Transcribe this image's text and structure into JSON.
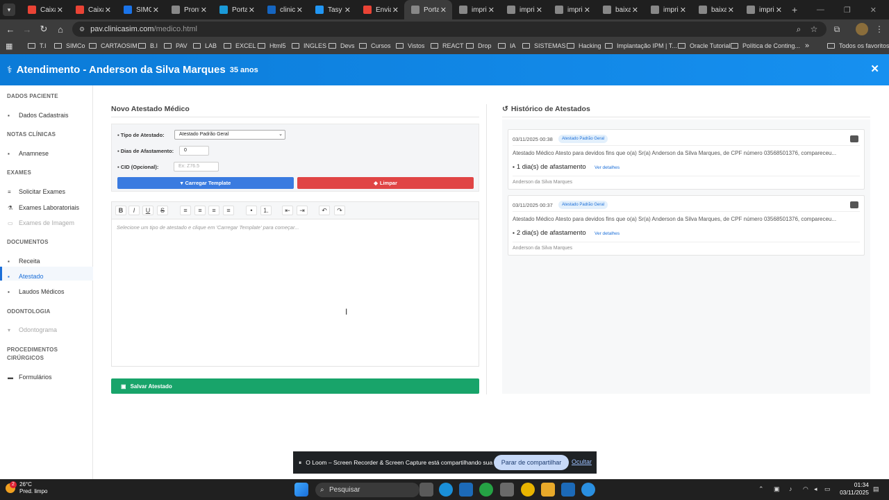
{
  "browser": {
    "tabs": [
      {
        "title": "Caixa",
        "icon": "gmail-icon",
        "color": "#ea4335"
      },
      {
        "title": "Caixa",
        "icon": "gmail-icon",
        "color": "#ea4335"
      },
      {
        "title": "SIMCo",
        "icon": "app-icon",
        "color": "#1a73e8"
      },
      {
        "title": "Pront",
        "icon": "globe-icon",
        "color": "#888888"
      },
      {
        "title": "Portal",
        "icon": "app-icon",
        "color": "#1a9ad8"
      },
      {
        "title": "clinica",
        "icon": "app-icon",
        "color": "#1565c0"
      },
      {
        "title": "Tasy",
        "icon": "app-icon",
        "color": "#2196f3"
      },
      {
        "title": "Enviad",
        "icon": "gmail-icon",
        "color": "#ea4335"
      },
      {
        "title": "Portal",
        "icon": "globe-icon",
        "color": "#888888"
      },
      {
        "title": "imprim",
        "icon": "globe-icon",
        "color": "#888888"
      },
      {
        "title": "imprim",
        "icon": "globe-icon",
        "color": "#888888"
      },
      {
        "title": "imprim",
        "icon": "globe-icon",
        "color": "#888888"
      },
      {
        "title": "baixar",
        "icon": "globe-icon",
        "color": "#888888"
      },
      {
        "title": "imprim",
        "icon": "globe-icon",
        "color": "#888888"
      },
      {
        "title": "baixar",
        "icon": "globe-icon",
        "color": "#888888"
      },
      {
        "title": "imprim",
        "icon": "globe-icon",
        "color": "#888888"
      }
    ],
    "new_tab": "+",
    "url_host": "pav.clinicasim.com",
    "url_path": "/medico.html",
    "bookmarks": [
      {
        "label": "T.I"
      },
      {
        "label": "SIMCo"
      },
      {
        "label": "CARTAOSIM"
      },
      {
        "label": "B.I"
      },
      {
        "label": "PAV"
      },
      {
        "label": "LAB"
      },
      {
        "label": "EXCEL"
      },
      {
        "label": "Html5"
      },
      {
        "label": "INGLES"
      },
      {
        "label": "Devs"
      },
      {
        "label": "Cursos"
      },
      {
        "label": "Vistos"
      },
      {
        "label": "REACT"
      },
      {
        "label": "Drop"
      },
      {
        "label": "IA"
      },
      {
        "label": "SISTEMAS"
      },
      {
        "label": "Hacking"
      },
      {
        "label": "Implantação IPM | T..."
      },
      {
        "label": "Oracle Tutorial"
      },
      {
        "label": "Política de Conting..."
      }
    ],
    "bookmarks_more": "»",
    "all_favorites": "Todos os favoritos"
  },
  "header": {
    "title": "Atendimento -  Anderson da Silva Marques",
    "age": "35 anos",
    "close": "✕",
    "accent": "#0b7bd8"
  },
  "sidebar": {
    "sections": [
      {
        "title": "DADOS PACIENTE",
        "items": [
          {
            "label": "Dados Cadastrais",
            "icon": "user-icon",
            "state": "normal"
          }
        ]
      },
      {
        "title": "NOTAS CLÍNICAS",
        "items": [
          {
            "label": "Anamnese",
            "icon": "clipboard-icon",
            "state": "normal"
          }
        ]
      },
      {
        "title": "EXAMES",
        "items": [
          {
            "label": "Solicitar Exames",
            "icon": "list-icon",
            "state": "normal"
          },
          {
            "label": "Exames Laboratoriais",
            "icon": "flask-icon",
            "state": "normal"
          },
          {
            "label": "Exames de Imagem",
            "icon": "image-icon",
            "state": "disabled"
          }
        ]
      },
      {
        "title": "DOCUMENTOS",
        "items": [
          {
            "label": "Receita",
            "icon": "prescription-icon",
            "state": "normal"
          },
          {
            "label": "Atestado",
            "icon": "document-icon",
            "state": "active"
          },
          {
            "label": "Laudos Médicos",
            "icon": "report-icon",
            "state": "normal"
          }
        ]
      },
      {
        "title": "ODONTOLOGIA",
        "items": [
          {
            "label": "Odontograma",
            "icon": "tooth-icon",
            "state": "disabled"
          }
        ]
      },
      {
        "title": "PROCEDIMENTOS CIRÚRGICOS",
        "items": [
          {
            "label": "Formulários",
            "icon": "form-icon",
            "state": "normal"
          }
        ]
      }
    ]
  },
  "form": {
    "title": "Novo Atestado Médico",
    "tipo_label": "Tipo de Atestado:",
    "tipo_value": "Atestado Padrão Geral",
    "dias_label": "Dias de Afastamento:",
    "dias_value": "0",
    "cid_label": "CID (Opcional):",
    "cid_placeholder": "Ex: Z76.5",
    "load_button": "Carregar Template",
    "clear_button": "Limpar",
    "load_color": "#3a7be0",
    "clear_color": "#e04545",
    "editor_placeholder": "Selecione um tipo de atestado e clique em 'Carregar Template' para começar...",
    "save_button": "Salvar Atestado",
    "save_color": "#18a46a"
  },
  "editor_toolbar": [
    {
      "name": "bold",
      "glyph": "B"
    },
    {
      "name": "italic",
      "glyph": "I"
    },
    {
      "name": "underline",
      "glyph": "U"
    },
    {
      "name": "strike",
      "glyph": "S"
    },
    {
      "name": "align-left",
      "glyph": "≡"
    },
    {
      "name": "align-center",
      "glyph": "≡"
    },
    {
      "name": "align-right",
      "glyph": "≡"
    },
    {
      "name": "justify",
      "glyph": "≡"
    },
    {
      "name": "bullet-list",
      "glyph": "•"
    },
    {
      "name": "numbered-list",
      "glyph": "1."
    },
    {
      "name": "outdent",
      "glyph": "⇤"
    },
    {
      "name": "indent",
      "glyph": "⇥"
    },
    {
      "name": "undo",
      "glyph": "↶"
    },
    {
      "name": "redo",
      "glyph": "↷"
    }
  ],
  "history": {
    "title": "Histórico de Atestados",
    "items": [
      {
        "date": "03/11/2025 00:38",
        "badge": "Atestado Padrão Geral",
        "text": "Atestado Médico Atesto para devidos fins que o(a) Sr(a) Anderson da Silva Marques, de CPF número 03568501376, compareceu...",
        "days": "1 dia(s) de afastamento",
        "more": "Ver detalhes",
        "user": "Anderson da Silva Marques"
      },
      {
        "date": "03/11/2025 00:37",
        "badge": "Atestado Padrão Geral",
        "text": "Atestado Médico Atesto para devidos fins que o(a) Sr(a) Anderson da Silva Marques, de CPF número 03568501376, compareceu...",
        "days": "2 dia(s) de afastamento",
        "more": "Ver detalhes",
        "user": "Anderson da Silva Marques"
      }
    ]
  },
  "loom": {
    "message": "O Loom – Screen Recorder & Screen Capture está compartilhando sua tela.",
    "stop": "Parar de compartilhar",
    "hide": "Ocultar"
  },
  "taskbar": {
    "temp": "26°C",
    "weather": "Pred. limpo",
    "search": "Pesquisar",
    "time": "01:34",
    "date": "03/11/2025",
    "badge": "2"
  }
}
